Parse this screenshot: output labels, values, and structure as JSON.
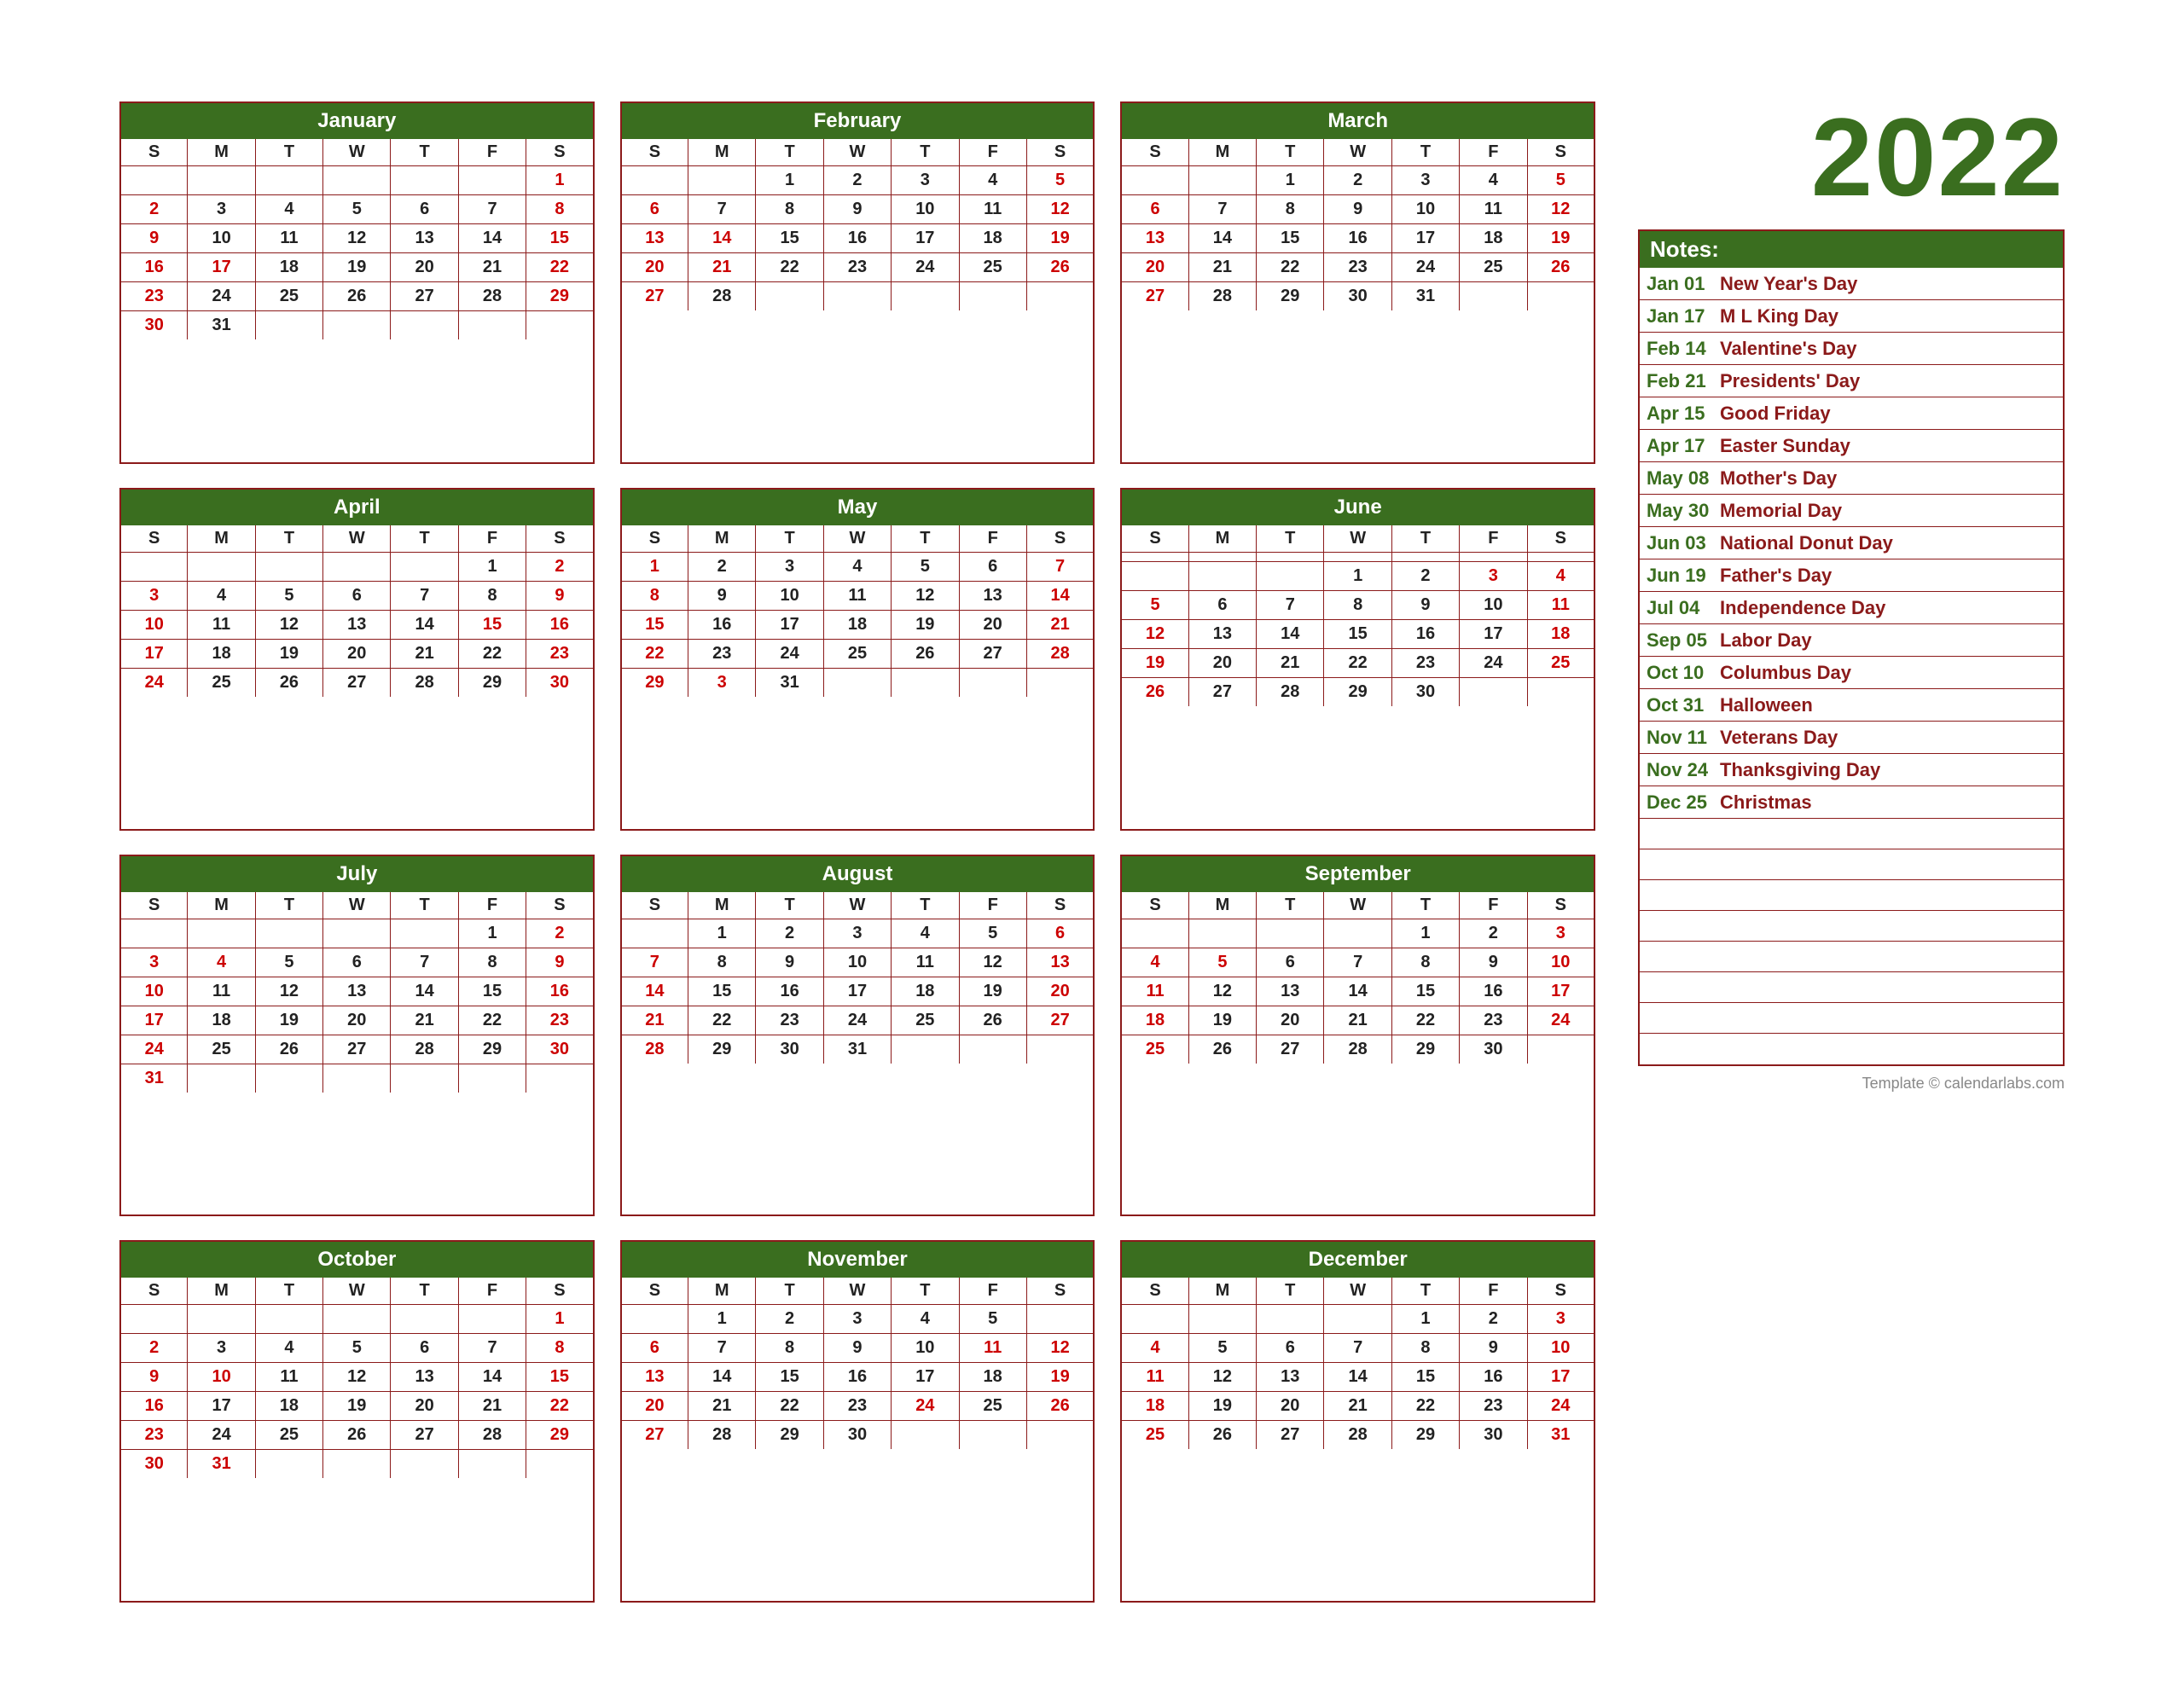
{
  "year": "2022",
  "watermark": "Template © calendarlabs.com",
  "months": [
    {
      "name": "January",
      "weeks": [
        [
          "",
          "",
          "",
          "",
          "",
          "",
          "1"
        ],
        [
          "2",
          "3",
          "4",
          "5",
          "6",
          "7",
          "8"
        ],
        [
          "9",
          "10",
          "11",
          "12",
          "13",
          "14",
          "15"
        ],
        [
          "16",
          "17",
          "18",
          "19",
          "20",
          "21",
          "22"
        ],
        [
          "23",
          "24",
          "25",
          "26",
          "27",
          "28",
          "29"
        ],
        [
          "30",
          "31",
          "",
          "",
          "",
          "",
          ""
        ]
      ],
      "holidays": [
        "1",
        "17"
      ],
      "sundays": [
        "2",
        "9",
        "16",
        "23",
        "30"
      ],
      "saturdays": [
        "1",
        "8",
        "15",
        "22",
        "29"
      ]
    },
    {
      "name": "February",
      "weeks": [
        [
          "",
          "",
          "1",
          "2",
          "3",
          "4",
          "5"
        ],
        [
          "6",
          "7",
          "8",
          "9",
          "10",
          "11",
          "12"
        ],
        [
          "13",
          "14",
          "15",
          "16",
          "17",
          "18",
          "19"
        ],
        [
          "20",
          "21",
          "22",
          "23",
          "24",
          "25",
          "26"
        ],
        [
          "27",
          "28",
          "",
          "",
          "",
          "",
          ""
        ]
      ],
      "holidays": [
        "14",
        "21"
      ],
      "sundays": [
        "6",
        "13",
        "20",
        "27"
      ],
      "saturdays": [
        "5",
        "12",
        "19",
        "26"
      ]
    },
    {
      "name": "March",
      "weeks": [
        [
          "",
          "",
          "1",
          "2",
          "3",
          "4",
          "5"
        ],
        [
          "6",
          "7",
          "8",
          "9",
          "10",
          "11",
          "12"
        ],
        [
          "13",
          "14",
          "15",
          "16",
          "17",
          "18",
          "19"
        ],
        [
          "20",
          "21",
          "22",
          "23",
          "24",
          "25",
          "26"
        ],
        [
          "27",
          "28",
          "29",
          "30",
          "31",
          "",
          ""
        ]
      ],
      "holidays": [],
      "sundays": [
        "6",
        "13",
        "20",
        "27"
      ],
      "saturdays": [
        "5",
        "12",
        "19",
        "26"
      ]
    },
    {
      "name": "April",
      "weeks": [
        [
          "",
          "",
          "",
          "",
          "",
          "1",
          "2"
        ],
        [
          "3",
          "4",
          "5",
          "6",
          "7",
          "8",
          "9"
        ],
        [
          "10",
          "11",
          "12",
          "13",
          "14",
          "15",
          "16"
        ],
        [
          "17",
          "18",
          "19",
          "20",
          "21",
          "22",
          "23"
        ],
        [
          "24",
          "25",
          "26",
          "27",
          "28",
          "29",
          "30"
        ]
      ],
      "holidays": [
        "15",
        "17"
      ],
      "sundays": [
        "3",
        "10",
        "17",
        "24"
      ],
      "saturdays": [
        "2",
        "9",
        "16",
        "23",
        "30"
      ]
    },
    {
      "name": "May",
      "weeks": [
        [
          "1",
          "2",
          "3",
          "4",
          "5",
          "6",
          "7"
        ],
        [
          "8",
          "9",
          "10",
          "11",
          "12",
          "13",
          "14"
        ],
        [
          "15",
          "16",
          "17",
          "18",
          "19",
          "20",
          "21"
        ],
        [
          "22",
          "23",
          "24",
          "25",
          "26",
          "27",
          "28"
        ],
        [
          "29",
          "3",
          "31",
          "",
          "",
          "",
          ""
        ]
      ],
      "holidays": [
        "8",
        "30"
      ],
      "sundays": [
        "1",
        "8",
        "15",
        "22",
        "29"
      ],
      "saturdays": [
        "7",
        "14",
        "21",
        "28"
      ]
    },
    {
      "name": "June",
      "weeks": [
        [
          "",
          "",
          "",
          "",
          "",
          "",
          ""
        ],
        [
          "",
          "",
          "",
          "1",
          "2",
          "3",
          "4"
        ],
        [
          "5",
          "6",
          "7",
          "8",
          "9",
          "10",
          "11"
        ],
        [
          "12",
          "13",
          "14",
          "15",
          "16",
          "17",
          "18"
        ],
        [
          "19",
          "20",
          "21",
          "22",
          "23",
          "24",
          "25"
        ],
        [
          "26",
          "27",
          "28",
          "29",
          "30",
          "",
          ""
        ]
      ],
      "holidays": [
        "3",
        "19"
      ],
      "sundays": [
        "5",
        "12",
        "19",
        "26"
      ],
      "saturdays": [
        "4",
        "11",
        "18",
        "25"
      ]
    },
    {
      "name": "July",
      "weeks": [
        [
          "",
          "",
          "",
          "",
          "",
          "1",
          "2"
        ],
        [
          "3",
          "4",
          "5",
          "6",
          "7",
          "8",
          "9"
        ],
        [
          "10",
          "11",
          "12",
          "13",
          "14",
          "15",
          "16"
        ],
        [
          "17",
          "18",
          "19",
          "20",
          "21",
          "22",
          "23"
        ],
        [
          "24",
          "25",
          "26",
          "27",
          "28",
          "29",
          "30"
        ],
        [
          "31",
          "",
          "",
          "",
          "",
          "",
          ""
        ]
      ],
      "holidays": [
        "4"
      ],
      "sundays": [
        "3",
        "10",
        "17",
        "24",
        "31"
      ],
      "saturdays": [
        "2",
        "9",
        "16",
        "23",
        "30"
      ]
    },
    {
      "name": "August",
      "weeks": [
        [
          "",
          "1",
          "2",
          "3",
          "4",
          "5",
          "6"
        ],
        [
          "7",
          "8",
          "9",
          "10",
          "11",
          "12",
          "13"
        ],
        [
          "14",
          "15",
          "16",
          "17",
          "18",
          "19",
          "20"
        ],
        [
          "21",
          "22",
          "23",
          "24",
          "25",
          "26",
          "27"
        ],
        [
          "28",
          "29",
          "30",
          "31",
          "",
          "",
          ""
        ]
      ],
      "holidays": [],
      "sundays": [
        "7",
        "14",
        "21",
        "28"
      ],
      "saturdays": [
        "6",
        "13",
        "20",
        "27"
      ]
    },
    {
      "name": "September",
      "weeks": [
        [
          "S",
          "M",
          "T",
          "W",
          "T",
          "F",
          "S"
        ],
        [
          "",
          "",
          "",
          "",
          "1",
          "2",
          "3"
        ],
        [
          "4",
          "5",
          "6",
          "7",
          "8",
          "9",
          "10"
        ],
        [
          "11",
          "12",
          "13",
          "14",
          "15",
          "16",
          "17"
        ],
        [
          "18",
          "19",
          "20",
          "21",
          "22",
          "23",
          "24"
        ],
        [
          "25",
          "26",
          "27",
          "28",
          "29",
          "30",
          ""
        ]
      ],
      "holidays": [
        "5"
      ],
      "sundays": [
        "4",
        "11",
        "18",
        "25"
      ],
      "saturdays": [
        "3",
        "10",
        "17",
        "24"
      ]
    },
    {
      "name": "October",
      "weeks": [
        [
          "",
          "",
          "",
          "",
          "",
          "",
          "1"
        ],
        [
          "2",
          "3",
          "4",
          "5",
          "6",
          "7",
          "8"
        ],
        [
          "9",
          "10",
          "11",
          "12",
          "13",
          "14",
          "15"
        ],
        [
          "16",
          "17",
          "18",
          "19",
          "20",
          "21",
          "22"
        ],
        [
          "23",
          "24",
          "25",
          "26",
          "27",
          "28",
          "29"
        ],
        [
          "30",
          "31",
          "",
          "",
          "",
          "",
          ""
        ]
      ],
      "holidays": [
        "10",
        "31"
      ],
      "sundays": [
        "2",
        "9",
        "16",
        "23",
        "30"
      ],
      "saturdays": [
        "1",
        "8",
        "15",
        "22",
        "29"
      ]
    },
    {
      "name": "November",
      "weeks": [
        [
          "",
          "1",
          "2",
          "3",
          "4",
          "5",
          ""
        ],
        [
          "6",
          "7",
          "8",
          "9",
          "10",
          "11",
          "12"
        ],
        [
          "13",
          "14",
          "15",
          "16",
          "17",
          "18",
          "19"
        ],
        [
          "20",
          "21",
          "22",
          "23",
          "24",
          "25",
          "26"
        ],
        [
          "27",
          "28",
          "29",
          "30",
          "",
          "",
          ""
        ]
      ],
      "holidays": [
        "11",
        "24"
      ],
      "sundays": [
        "6",
        "13",
        "20",
        "27"
      ],
      "saturdays": [
        "5",
        "12",
        "19",
        "26"
      ]
    },
    {
      "name": "December",
      "weeks": [
        [
          "",
          "",
          "",
          "",
          "1",
          "2",
          "3"
        ],
        [
          "4",
          "5",
          "6",
          "7",
          "8",
          "9",
          "10"
        ],
        [
          "11",
          "12",
          "13",
          "14",
          "15",
          "16",
          "17"
        ],
        [
          "18",
          "19",
          "20",
          "21",
          "22",
          "23",
          "24"
        ],
        [
          "25",
          "26",
          "27",
          "28",
          "29",
          "30",
          "31"
        ]
      ],
      "holidays": [
        "25"
      ],
      "sundays": [
        "4",
        "11",
        "18",
        "25"
      ],
      "saturdays": [
        "3",
        "10",
        "17",
        "24",
        "31"
      ]
    }
  ],
  "notes_header": "Notes:",
  "holidays": [
    {
      "date": "Jan 01",
      "name": "New Year's Day"
    },
    {
      "date": "Jan 17",
      "name": "M L King Day"
    },
    {
      "date": "Feb 14",
      "name": "Valentine's Day"
    },
    {
      "date": "Feb 21",
      "name": "Presidents' Day"
    },
    {
      "date": "Apr 15",
      "name": "Good Friday"
    },
    {
      "date": "Apr 17",
      "name": "Easter Sunday"
    },
    {
      "date": "May 08",
      "name": "Mother's Day"
    },
    {
      "date": "May 30",
      "name": "Memorial Day"
    },
    {
      "date": "Jun 03",
      "name": "National Donut Day"
    },
    {
      "date": "Jun 19",
      "name": "Father's Day"
    },
    {
      "date": "Jul 04",
      "name": "Independence Day"
    },
    {
      "date": "Sep 05",
      "name": "Labor Day"
    },
    {
      "date": "Oct 10",
      "name": "Columbus Day"
    },
    {
      "date": "Oct 31",
      "name": "Halloween"
    },
    {
      "date": "Nov 11",
      "name": "Veterans Day"
    },
    {
      "date": "Nov 24",
      "name": "Thanksgiving Day"
    },
    {
      "date": "Dec 25",
      "name": "Christmas"
    }
  ],
  "days_header": [
    "S",
    "M",
    "T",
    "W",
    "T",
    "F",
    "S"
  ]
}
